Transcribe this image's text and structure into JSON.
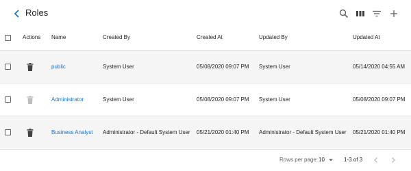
{
  "header": {
    "title": "Roles",
    "icons": [
      "back-chevron-icon",
      "search-icon",
      "columns-icon",
      "filter-icon",
      "add-icon"
    ]
  },
  "table": {
    "columns": [
      "Actions",
      "Name",
      "Created By",
      "Created At",
      "Updated By",
      "Updated At"
    ],
    "rows": [
      {
        "name": "public",
        "created_by": "System User",
        "created_at": "05/08/2020 09:07 PM",
        "updated_by": "System User",
        "updated_at": "05/14/2020 04:55 AM",
        "delete_enabled": true
      },
      {
        "name": "Administrator",
        "created_by": "System User",
        "created_at": "05/08/2020 09:07 PM",
        "updated_by": "System User",
        "updated_at": "05/08/2020 09:07 PM",
        "delete_enabled": false
      },
      {
        "name": "Business Analyst",
        "created_by": "Administrator - Default System User",
        "created_at": "05/21/2020 01:40 PM",
        "updated_by": "Administrator - Default System User",
        "updated_at": "05/21/2020 01:40 PM",
        "delete_enabled": true
      }
    ]
  },
  "footer": {
    "rows_per_page_label": "Rows per page:",
    "rows_per_page_value": "10",
    "range": "1-3 of 3"
  },
  "colors": {
    "accent": "#1976d2",
    "row_shaded": "#f5f5f5",
    "icon": "#424242",
    "icon_disabled": "#bdbdbd"
  }
}
